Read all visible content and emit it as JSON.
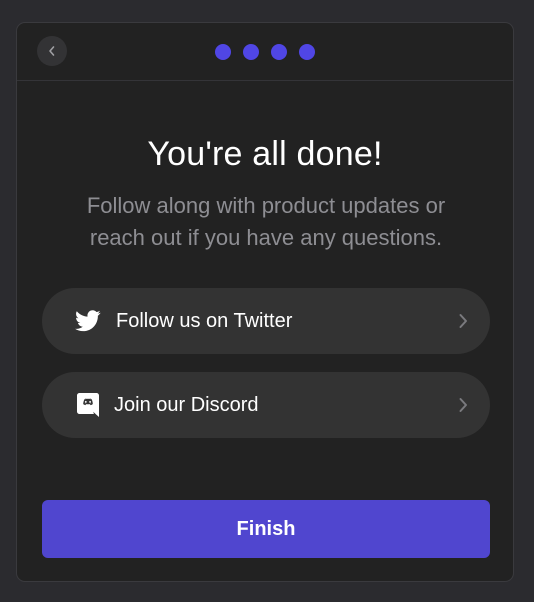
{
  "header": {
    "back_icon": "chevron-left-icon",
    "steps_total": 4,
    "steps_completed": 4,
    "step_color": "#5046e5"
  },
  "content": {
    "title": "You're all done!",
    "subtitle": "Follow along with product updates or reach out if you have any questions."
  },
  "links": [
    {
      "label": "Follow us on Twitter",
      "icon": "twitter-icon"
    },
    {
      "label": "Join our Discord",
      "icon": "discord-icon"
    }
  ],
  "footer": {
    "finish_label": "Finish",
    "accent": "#5046cf"
  }
}
